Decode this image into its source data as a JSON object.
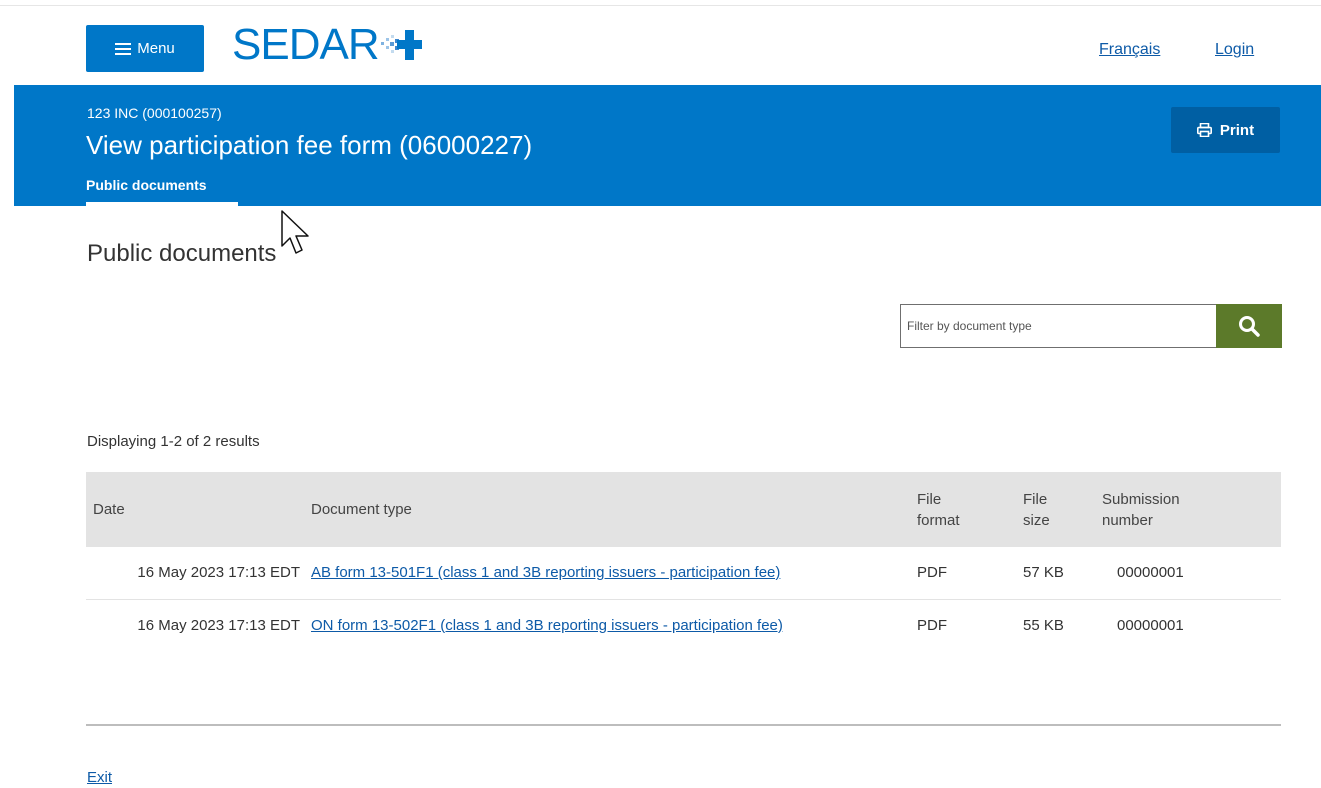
{
  "header": {
    "menu_label": "Menu",
    "logo_text": "SEDAR",
    "lang_link": "Français",
    "login_link": "Login"
  },
  "banner": {
    "issuer": "123 INC (000100257)",
    "title": "View participation fee form (06000227)",
    "active_tab": "Public documents",
    "print_label": "Print"
  },
  "main": {
    "heading": "Public documents",
    "filter_placeholder": "Filter by document type",
    "results_count": "Displaying 1-2 of 2 results"
  },
  "table": {
    "columns": {
      "date": "Date",
      "document_type": "Document type",
      "file_format": "File format",
      "file_size": "File size",
      "submission_number": "Submission number"
    },
    "rows": [
      {
        "date": "16 May 2023 17:13 EDT",
        "document_type": "AB form 13-501F1 (class 1 and 3B reporting issuers - participation fee)",
        "file_format": "PDF",
        "file_size": "57 KB",
        "submission_number": "00000001"
      },
      {
        "date": "16 May 2023 17:13 EDT",
        "document_type": "ON form 13-502F1 (class 1 and 3B reporting issuers - participation fee)",
        "file_format": "PDF",
        "file_size": "55 KB",
        "submission_number": "00000001"
      }
    ]
  },
  "footer": {
    "exit_link": "Exit"
  },
  "colors": {
    "brand_blue": "#0077c8",
    "print_button": "#005fa3",
    "search_button": "#5c7a2a",
    "link": "#0d5aa7",
    "table_header_bg": "#e3e3e3"
  },
  "icons": {
    "menu": "hamburger-icon",
    "print": "printer-icon",
    "search": "search-icon",
    "logo_mark": "plus-icon",
    "cursor": "mouse-pointer-icon"
  }
}
